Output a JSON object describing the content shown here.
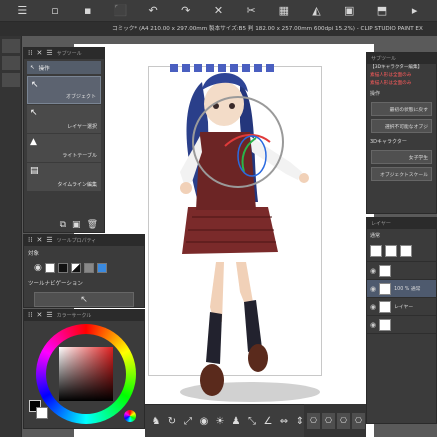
{
  "toolbar": {
    "icons": [
      "menu-icon",
      "new-file-icon",
      "open-folder-icon",
      "save-icon",
      "undo-icon",
      "redo-icon",
      "erase-icon",
      "cut-icon",
      "paste-icon",
      "fill-icon",
      "select-icon",
      "transform-icon",
      "more-icon"
    ],
    "glyphs": [
      "☰",
      "▫",
      "▪",
      "⬛",
      "↶",
      "↷",
      "✕",
      "✂",
      "▦",
      "◭",
      "▣",
      "⬒",
      "▸"
    ]
  },
  "canvas": {
    "title": "コミック* (A4 210.00 x 297.00mm 製本サイズ:B5 判 182.00 x 257.00mm 600dpi 15.2%) - CLIP STUDIO PAINT EX"
  },
  "subtool": {
    "header": "サブツール",
    "group": "操作",
    "items": [
      {
        "label": "オブジェクト",
        "icon": "object-select-icon"
      },
      {
        "label": "レイヤー選択",
        "icon": "layer-select-icon"
      },
      {
        "label": "ライトテーブル",
        "icon": "light-table-icon"
      },
      {
        "label": "タイムライン編集",
        "icon": "timeline-edit-icon"
      }
    ]
  },
  "toolprop": {
    "header": "ツールプロパティ",
    "row_label": "対象",
    "nav_label": "ツールナビゲーション"
  },
  "color": {
    "header": "カラーサークル"
  },
  "object_panel": {
    "header": "サブツール",
    "title": "【3Dキャラクター編集】",
    "warning1": "素描人形は全面のみ",
    "warning2": "素描人形は全面のみ",
    "section": "操作",
    "button1": "最初の状態に戻す",
    "button2": "選択不可能なオブジ",
    "char_label": "3Dキャラクター",
    "char_value": "女子学生",
    "scale_label": "オブジェクトスケール"
  },
  "layer_panel": {
    "header": "レイヤー",
    "mode": "通常",
    "rows": [
      {
        "label": "",
        "thumb": true
      },
      {
        "label": "100 % 通常",
        "thumb": true
      },
      {
        "label": "レイヤー",
        "thumb": true
      },
      {
        "label": "",
        "thumb": true
      }
    ]
  },
  "bottom": {
    "icons": [
      "figure-icon",
      "rotate-icon",
      "move-icon",
      "camera-icon",
      "light-icon",
      "pose-icon",
      "scale-icon",
      "angle-icon",
      "pan-icon",
      "tilt-icon"
    ],
    "glyphs": [
      "♞",
      "↻",
      "⤢",
      "◉",
      "☀",
      "♟",
      "⤡",
      "∠",
      "⇔",
      "⇕"
    ],
    "mini_glyphs": [
      "⎔",
      "⎔",
      "⎔",
      "⎔"
    ]
  },
  "colors": {
    "panel_bg": "#3b3b3b",
    "accent": "#5c6370",
    "warning": "#ff5b5b"
  }
}
